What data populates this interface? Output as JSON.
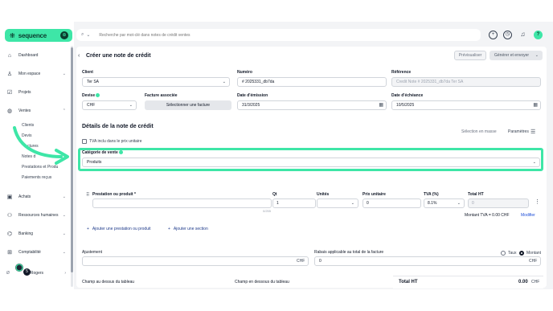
{
  "brand": {
    "name": "sequence",
    "accent": "#3ee6a7",
    "dark": "#0b3b2e"
  },
  "search": {
    "placeholder": "Recherche par mot-clé dans notes de crédit ventes"
  },
  "topbar": {
    "icons": [
      "plus-icon",
      "clock-icon",
      "bell-icon",
      "help-icon"
    ],
    "help_glyph": "?"
  },
  "sidebar": {
    "items": [
      {
        "label": "Dashboard",
        "icon": "home-icon"
      },
      {
        "label": "Mon espace",
        "icon": "user-icon"
      },
      {
        "label": "Projets",
        "icon": "check-square-icon"
      },
      {
        "label": "Ventes",
        "icon": "bag-icon"
      },
      {
        "label": "Achats",
        "icon": "shopping-icon"
      },
      {
        "label": "Ressources humaines",
        "icon": "people-icon"
      },
      {
        "label": "Banking",
        "icon": "bank-icon"
      },
      {
        "label": "Comptabilité",
        "icon": "calculator-icon"
      }
    ],
    "sub_items": [
      "Clients",
      "Devis",
      "ctures",
      "Notes d",
      "Prestations et Produ",
      "Paiements reçus"
    ],
    "user_label": "Rogers",
    "user_prefix": "Ø",
    "badge": "5"
  },
  "page": {
    "title": "Créer une note de crédit",
    "preview_button": "Prévisualiser",
    "generate_button": "Générer et envoyer"
  },
  "form": {
    "client": {
      "label": "Client",
      "value": "Ter SA"
    },
    "numero": {
      "label": "Numéro",
      "value": "# 2025331_db7da"
    },
    "reference": {
      "label": "Référence",
      "placeholder": "Credit Note # 2025331_db7da Ter SA"
    },
    "devise": {
      "label": "Devise",
      "value": "CHF"
    },
    "facture": {
      "label": "Facture associée",
      "button": "Sélectionner une facture"
    },
    "emission": {
      "label": "Date d'émission",
      "value": "31/3/2025"
    },
    "echeance": {
      "label": "Date d'échéance",
      "value": "10/5/2025"
    }
  },
  "details": {
    "title": "Détails de la note de crédit",
    "mouse_select": "Sélection en masse",
    "params": "Paramètres",
    "tva_checkbox": "TVA inclu dans le prix unitaire",
    "category": {
      "label": "Catégorie de vente",
      "value": "Produits"
    }
  },
  "line_table": {
    "headers": {
      "product": "Prestation ou produit *",
      "qty": "Qt",
      "units": "Unités",
      "unit_price": "Prix unitaire",
      "tva": "TVA (%)",
      "total": "Total HT"
    },
    "row": {
      "qty": "1",
      "unit_price": "0",
      "tva": "8.1%",
      "total": "0"
    },
    "char_count": "0/255",
    "tva_total_label": "Montant TVA =",
    "tva_total_value": "0.00 CHF",
    "edit": "Modifier",
    "add_line": "Ajouter une prestation ou produit",
    "add_section": "Ajouter une section"
  },
  "adjustments": {
    "adjustment_label": "Ajustement",
    "adjustment_suffix": "CHF",
    "discount_label": "Rabais applicable au total de la facture",
    "discount_value": "0",
    "discount_suffix": "CHF",
    "radio_rate": "Taux",
    "radio_amount": "Montant",
    "selected": "Montant"
  },
  "footer": {
    "above_table": "Champ au dessus du tableau",
    "below_table": "Champ en dessous du tableau",
    "total_label": "Total HT",
    "total_value": "0.00",
    "total_currency": "CHF"
  }
}
